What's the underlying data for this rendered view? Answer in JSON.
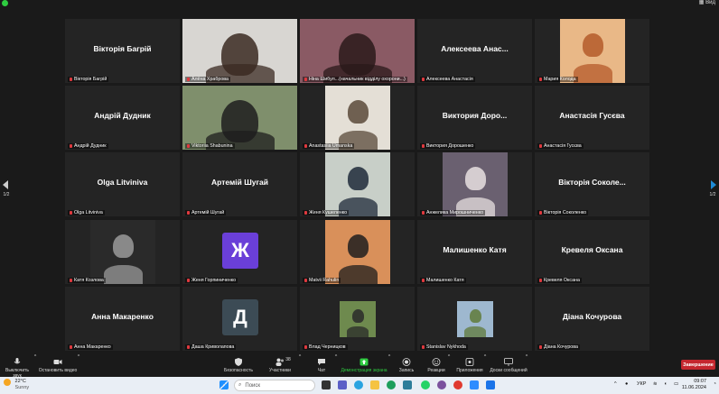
{
  "topbar": {
    "view_label": "Вид"
  },
  "pager": {
    "left": "1/2",
    "right": "1/2"
  },
  "tiles": [
    {
      "name": "Вікторія Багрій",
      "label": "Вікторія Багрій",
      "type": "name"
    },
    {
      "label": "Алёна Храброва",
      "type": "photo",
      "bg": "#d8d6d2",
      "fg": "#3b2a22"
    },
    {
      "label": "Ніна Шибул...(начальник відділу охорони...)",
      "type": "photo",
      "bg": "#8a5a64",
      "fg": "#2a1a1a",
      "active": true
    },
    {
      "name": "Алексеева Анас...",
      "label": "Алексеева Анастасія",
      "type": "name"
    },
    {
      "label": "Мария Колода",
      "type": "photo",
      "bg": "#e9b887",
      "fg": "#b45a2a",
      "small": true
    },
    {
      "name": "Андрій Дудник",
      "label": "Андрій Дудник",
      "type": "name"
    },
    {
      "label": "Viktoriia Shabunina",
      "type": "photo",
      "bg": "#7f8f6c",
      "fg": "#1e1e1e"
    },
    {
      "label": "Anastasiia Umanska",
      "type": "photo",
      "bg": "#e4dfd6",
      "fg": "#5a4a3a",
      "small": true
    },
    {
      "name": "Виктория Доро...",
      "label": "Виктория Дорошенко",
      "type": "name"
    },
    {
      "name": "Анастасія Гусєва",
      "label": "Анастасія Гусєва",
      "type": "name"
    },
    {
      "name": "Olga Litviniva",
      "label": "Olga Litviniva",
      "type": "name"
    },
    {
      "name": "Артемій Шугай",
      "label": "Артемій Шугай",
      "type": "name"
    },
    {
      "label": "Женя Кушеленко",
      "type": "photo",
      "bg": "#c8cfc8",
      "fg": "#1f2a3a",
      "small": true
    },
    {
      "label": "Анжелика Мирошниченко",
      "type": "photo",
      "bg": "#6a6070",
      "fg": "#e8e0e0",
      "small": true
    },
    {
      "name": "Вікторія Соколе...",
      "label": "Вікторія Соколенко",
      "type": "name"
    },
    {
      "label": "Катя Козлова",
      "type": "photo",
      "bg": "#2a2a2a",
      "fg": "#9a9a9a",
      "small": true
    },
    {
      "label": "Женя Горпиниченко",
      "type": "avatar",
      "letter": "Ж",
      "color": "#6a3fd8"
    },
    {
      "label": "Matvii Rahulin",
      "type": "photo",
      "bg": "#d9905a",
      "fg": "#1e1e1e",
      "small": true
    },
    {
      "name": "Малишенко Катя",
      "label": "Малишенко Катя",
      "type": "name"
    },
    {
      "name": "Кревеля Оксана",
      "label": "Кревеля Оксана",
      "type": "name"
    },
    {
      "name": "Анна Макаренко",
      "label": "Анна Макаренко",
      "type": "name"
    },
    {
      "label": "Даша Криволапова",
      "type": "avatar",
      "letter": "Д",
      "color": "#3c4b55"
    },
    {
      "label": "Влад Черницков",
      "type": "photo",
      "bg": "#6e8a4e",
      "fg": "#2a2a2a",
      "tiny": true
    },
    {
      "label": "Stanislav Nykhoda",
      "type": "photo",
      "bg": "#9eb8cf",
      "fg": "#5f7a3a",
      "tiny": true
    },
    {
      "name": "Діана Кочурова",
      "label": "Діана Кочурова",
      "type": "name"
    }
  ],
  "toolbar": {
    "mute": "Выключить звук",
    "video": "Остановить видео",
    "security": "Безопасность",
    "participants": "Участники",
    "participants_count": "38",
    "chat": "Чат",
    "share": "Демонстрация экрана",
    "record": "Запись",
    "reactions": "Реакции",
    "apps": "Приложения",
    "whiteboards": "Доски сообщений",
    "end": "Завершение"
  },
  "taskbar": {
    "temp": "22°C",
    "condition": "Sunny",
    "search_placeholder": "Поиск",
    "lang": "УКР",
    "time": "09:07",
    "date": "11.06.2024"
  },
  "colors": {
    "accent_share": "#2ecc40",
    "end_button": "#c4262e",
    "active_speaker": "#c6e33c"
  }
}
